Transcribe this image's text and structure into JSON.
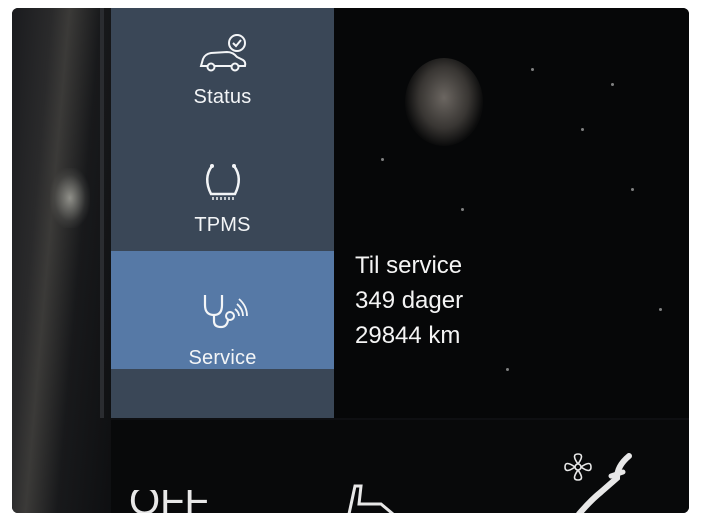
{
  "sidebar": {
    "items": [
      {
        "label": "Status",
        "icon": "car-check-icon",
        "active": false
      },
      {
        "label": "TPMS",
        "icon": "tire-pressure-icon",
        "active": false
      },
      {
        "label": "Service",
        "icon": "stethoscope-icon",
        "active": true
      }
    ]
  },
  "service_info": {
    "title": "Til service",
    "days": "349 dager",
    "distance": "29844 km"
  },
  "bottom_bar": {
    "left_text": "OFF",
    "icons": [
      "seat-icon",
      "fan-icon",
      "seat-heat-icon"
    ]
  },
  "colors": {
    "sidebar_bg": "#3a4757",
    "active_item_bg": "#5679a6",
    "screen_bg": "#060708",
    "text": "#f4f4f4"
  }
}
